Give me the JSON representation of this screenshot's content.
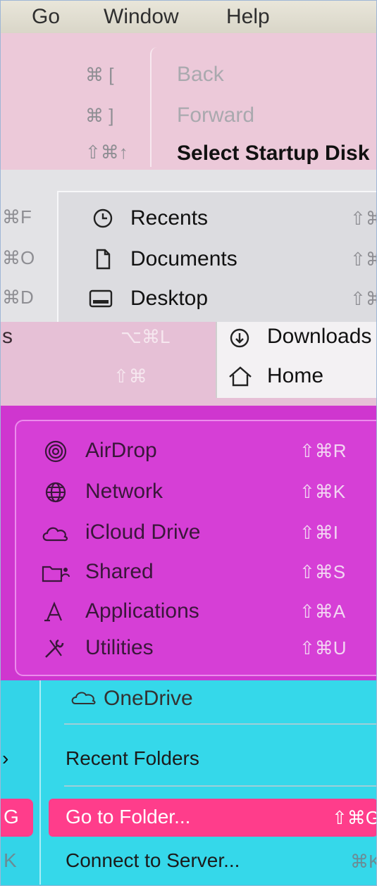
{
  "menubar": {
    "go": "Go",
    "window": "Window",
    "help": "Help"
  },
  "go_menu_top": [
    {
      "label": "Back",
      "shortcut": "⌘ ["
    },
    {
      "label": "Forward",
      "shortcut": "⌘ ]"
    },
    {
      "label": "Select Startup Disk",
      "shortcut": "⇧⌘↑"
    }
  ],
  "places": [
    {
      "label": "Recents",
      "shortcut": "⇧⌘",
      "left_shortcut": "⌘F",
      "icon": "clock-icon"
    },
    {
      "label": "Documents",
      "shortcut": "⇧⌘",
      "left_shortcut": "⌘O",
      "icon": "document-icon"
    },
    {
      "label": "Desktop",
      "shortcut": "⇧⌘",
      "left_shortcut": "⌘D",
      "icon": "desktop-icon"
    }
  ],
  "layer3": {
    "left_label": "s",
    "left_shortcut": "⌥⌘L",
    "left_shortcut2": "⇧⌘",
    "items": [
      {
        "label": "Downloads",
        "icon": "download-icon"
      },
      {
        "label": "Home",
        "icon": "home-icon"
      }
    ]
  },
  "locations": [
    {
      "label": "AirDrop",
      "shortcut": "⇧⌘R",
      "icon": "airdrop-icon"
    },
    {
      "label": "Network",
      "shortcut": "⇧⌘K",
      "icon": "network-icon"
    },
    {
      "label": "iCloud Drive",
      "shortcut": "⇧⌘I",
      "icon": "cloud-icon"
    },
    {
      "label": "Shared",
      "shortcut": "⇧⌘S",
      "icon": "shared-folder-icon"
    },
    {
      "label": "Applications",
      "shortcut": "⇧⌘A",
      "icon": "applications-icon"
    },
    {
      "label": "Utilities",
      "shortcut": "⇧⌘U",
      "icon": "utilities-icon"
    }
  ],
  "onedrive": {
    "label": "OneDrive"
  },
  "bottom_menu": {
    "recent_folders": "Recent Folders",
    "submenu_arrow": "›",
    "go_to_folder": "Go to Folder...",
    "go_to_folder_shortcut": "⇧⌘G",
    "go_to_folder_left": "G",
    "connect_to_server": "Connect to Server...",
    "connect_shortcut": "⌘K",
    "connect_left": "K"
  }
}
